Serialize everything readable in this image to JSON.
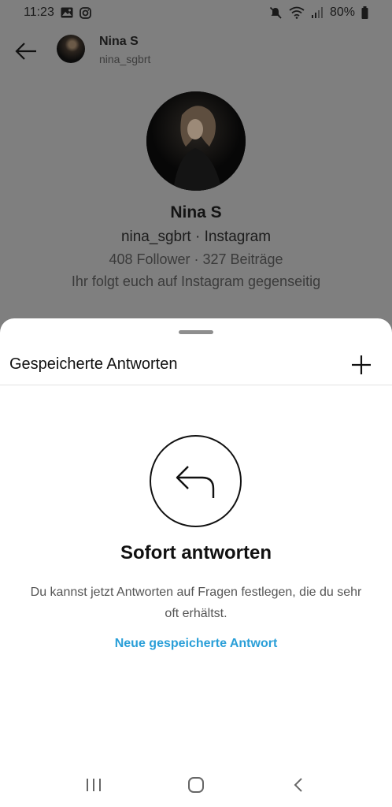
{
  "status_bar": {
    "time": "11:23",
    "battery": "80%",
    "icons_left": [
      "gallery-icon",
      "instagram-icon"
    ],
    "icons_right": [
      "mute-icon",
      "wifi-icon",
      "signal-icon",
      "battery-icon"
    ]
  },
  "header": {
    "name": "Nina S",
    "username": "nina_sgbrt"
  },
  "profile": {
    "name": "Nina S",
    "subtitle": "nina_sgbrt · Instagram",
    "stats": "408 Follower · 327 Beiträge",
    "mutual": "Ihr folgt euch auf Instagram gegenseitig"
  },
  "sheet": {
    "title": "Gespeicherte Antworten",
    "empty_title": "Sofort antworten",
    "empty_description": "Du kannst jetzt Antworten auf Fragen festlegen, die du sehr oft erhältst.",
    "new_link": "Neue gespeicherte Antwort"
  },
  "colors": {
    "accent": "#2a9fd8",
    "scrim": "#7f7f7f",
    "sheet_bg": "#ffffff"
  }
}
